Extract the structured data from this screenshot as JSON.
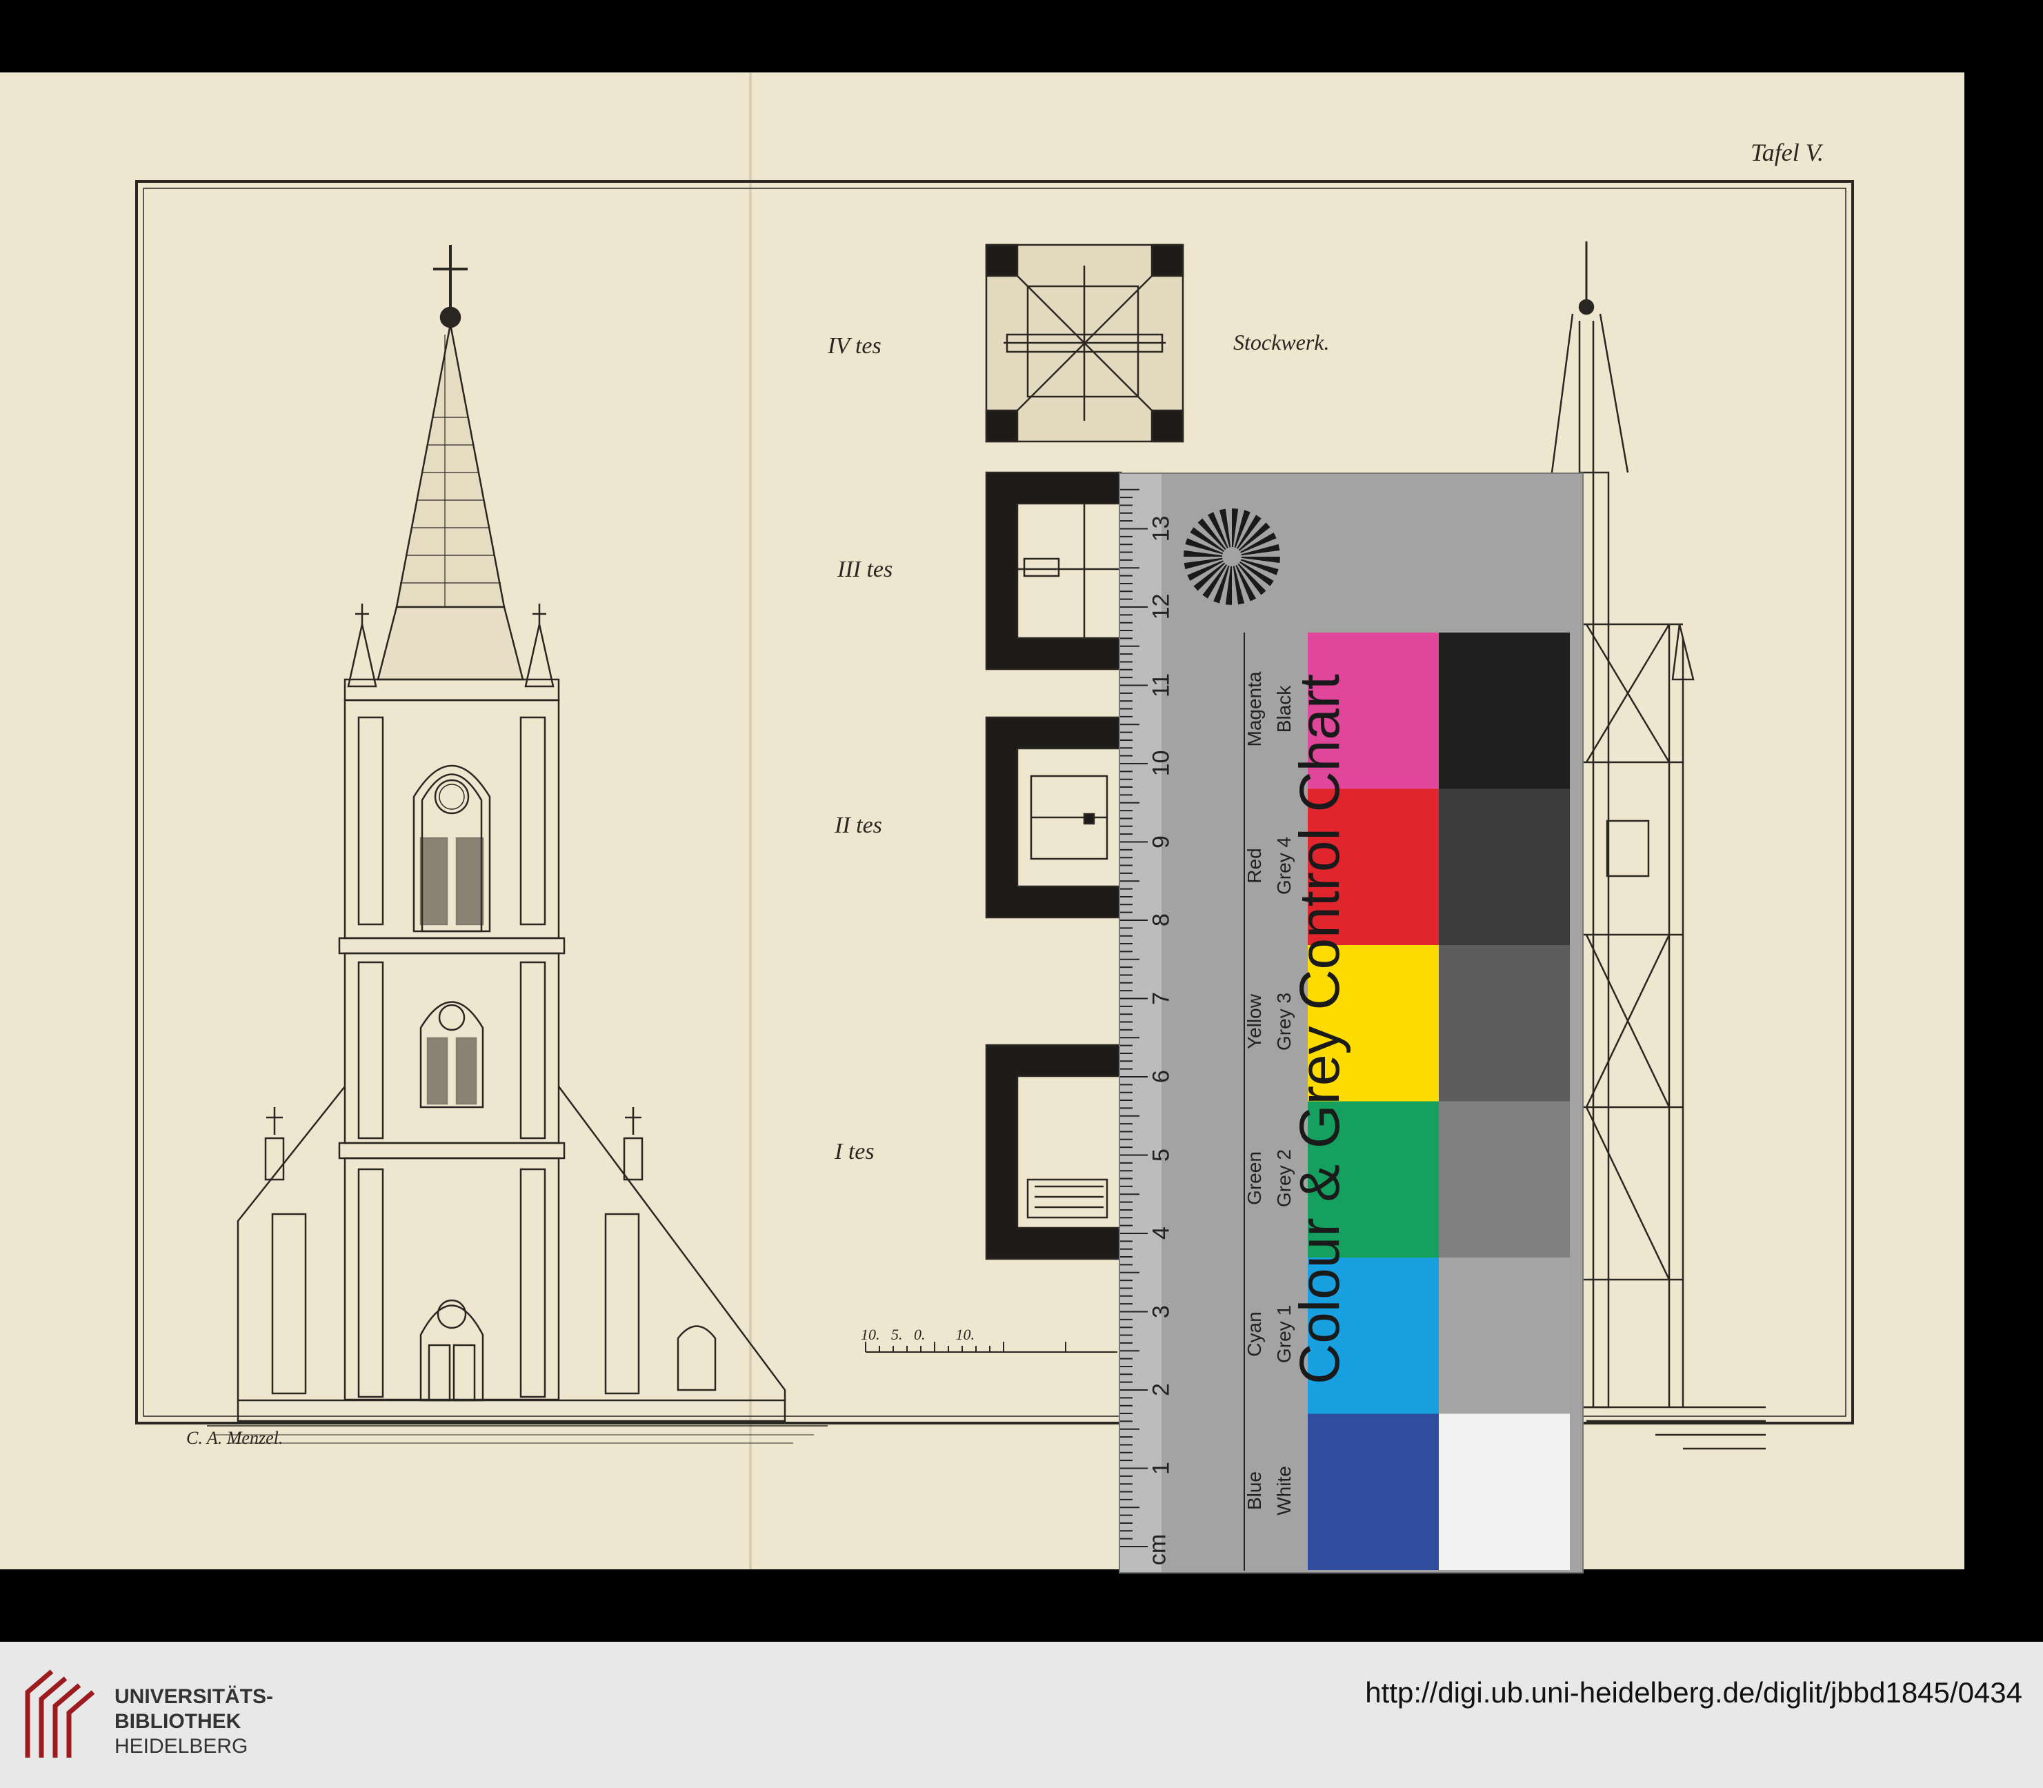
{
  "plate": {
    "tafel": "Tafel V.",
    "stockwerk": "Stockwerk.",
    "floors": [
      "IV tes",
      "III tes",
      "II tes",
      "I tes"
    ],
    "author": "C. A. Menzel.",
    "scale_numbers": "10.   5.   0.        10."
  },
  "card": {
    "title": "Colour & Grey Control Chart",
    "cm_unit": "cm",
    "cm_ticks": [
      "1",
      "2",
      "3",
      "4",
      "5",
      "6",
      "7",
      "8",
      "9",
      "10",
      "11",
      "12",
      "13"
    ],
    "colour_patches": [
      {
        "name": "Magenta",
        "color": "#e0479a"
      },
      {
        "name": "Red",
        "color": "#e0262c"
      },
      {
        "name": "Yellow",
        "color": "#ffdc00"
      },
      {
        "name": "Green",
        "color": "#15a060"
      },
      {
        "name": "Cyan",
        "color": "#18a0e0"
      },
      {
        "name": "Blue",
        "color": "#2f4c9e"
      }
    ],
    "grey_patches": [
      {
        "name": "Black",
        "color": "#1f1f1f"
      },
      {
        "name": "Grey 4",
        "color": "#3b3b3b"
      },
      {
        "name": "Grey 3",
        "color": "#5d5d5d"
      },
      {
        "name": "Grey 2",
        "color": "#808080"
      },
      {
        "name": "Grey 1",
        "color": "#a6a6a6"
      },
      {
        "name": "White",
        "color": "#f2f2f2"
      }
    ]
  },
  "footer": {
    "logo_line1": "UNIVERSITÄTS-",
    "logo_line2": "BIBLIOTHEK",
    "logo_line3": "HEIDELBERG",
    "url": "http://digi.ub.uni-heidelberg.de/diglit/jbbd1845/0434"
  }
}
